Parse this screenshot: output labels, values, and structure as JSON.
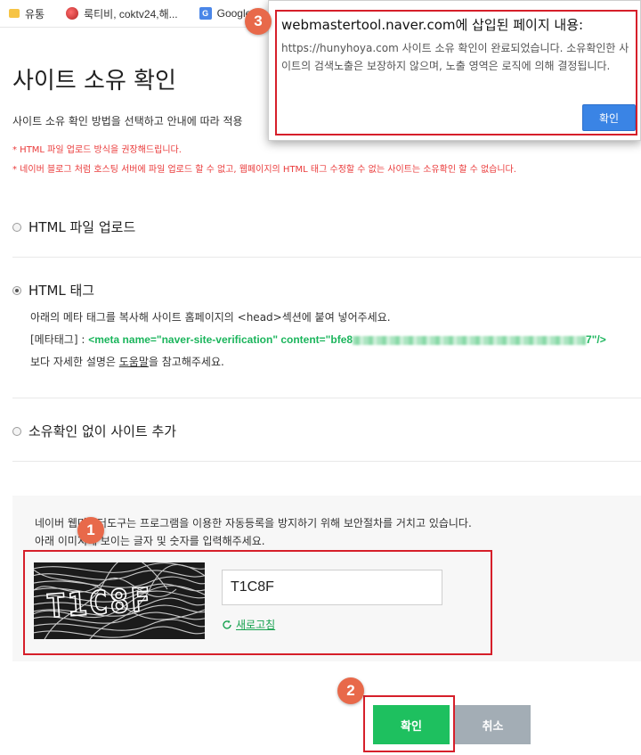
{
  "bookmarks": [
    {
      "label": "유통",
      "icon": "folder-icon"
    },
    {
      "label": "룩티비, coktv24,해...",
      "icon": "site-icon"
    },
    {
      "label": "Google",
      "icon": "google-translate-icon"
    }
  ],
  "page": {
    "title": "사이트 소유 확인",
    "description": "사이트 소유 확인 방법을 선택하고 안내에 따라 적용",
    "notes": [
      "* HTML 파일 업로드 방식을 권장해드립니다.",
      "* 네이버 블로그 처럼 호스팅 서버에 파일 업로드 할 수 없고, 웹페이지의 HTML 태그 수정할 수 없는 사이트는 소유확인 할 수 없습니다."
    ]
  },
  "options": {
    "upload": {
      "label": "HTML 파일 업로드",
      "selected": false
    },
    "tag": {
      "label": "HTML 태그",
      "selected": true,
      "instruction": "아래의 메타 태그를 복사해 사이트 홈페이지의 <head>섹션에 붙여 넣어주세요.",
      "meta_label": "[메타태그] : ",
      "meta_prefix": "<meta name=\"naver-site-verification\" content=\"bfe8",
      "meta_suffix": "7\"/>",
      "help_before": "보다 자세한 설명은 ",
      "help_link": "도움말",
      "help_after": "을 참고해주세요."
    },
    "no_verify": {
      "label": "소유확인 없이 사이트 추가",
      "selected": false
    }
  },
  "captcha": {
    "line1": "네이버 웹마스터도구는 프로그램을 이용한 자동등록을 방지하기 위해 보안절차를 거치고 있습니다.",
    "line2": "아래 이미지에 보이는 글자 및 숫자를 입력해주세요.",
    "image_text": "T1C8F",
    "input_value": "T1C8F",
    "refresh_label": "새로고침"
  },
  "buttons": {
    "confirm": "확인",
    "cancel": "취소"
  },
  "dialog": {
    "title": "webmastertool.naver.com에 삽입된 페이지 내용:",
    "message": "https://hunyhoya.com 사이트 소유 확인이 완료되었습니다. 소유확인한 사이트의 검색노출은 보장하지 않으며, 노출 영역은 로직에 의해 결정됩니다.",
    "ok": "확인"
  },
  "annotations": [
    "1",
    "2",
    "3"
  ],
  "colors": {
    "accent_green": "#1ec05f",
    "highlight_red": "#d61f2a",
    "badge": "#e8694a",
    "dialog_button": "#3a84e5"
  }
}
